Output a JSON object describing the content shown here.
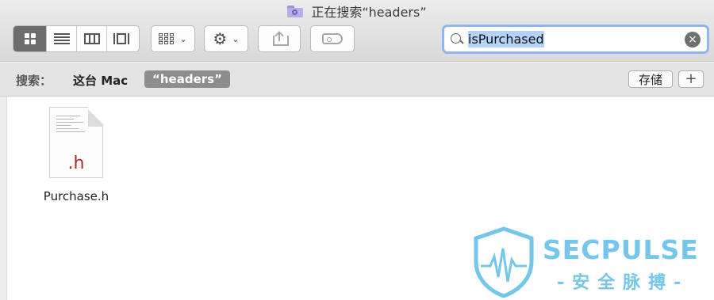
{
  "window": {
    "title": "正在搜索“headers”"
  },
  "toolbar": {
    "view_modes": [
      "icon-view",
      "list-view",
      "column-view",
      "cover-flow-view"
    ],
    "active_view": "icon-view",
    "arrange_icon": "grid-arrange-icon",
    "action_icon": "gear-icon",
    "share_icon": "share-icon",
    "tag_icon": "tag-icon"
  },
  "search": {
    "query": "isPurchased",
    "clear_icon": "clear-icon"
  },
  "scope": {
    "label": "搜索：",
    "this_mac": "这台 Mac",
    "folder": "“headers”",
    "save_label": "存储",
    "add_label": "+"
  },
  "results": [
    {
      "name": "Purchase.h",
      "ext": ".h"
    }
  ],
  "watermark": {
    "name": "SECPULSE",
    "sub": "-安全脉搏-"
  },
  "colors": {
    "selection": "#b3d3fb",
    "search_focus": "#8fb6ee",
    "extension": "#a82a2a",
    "watermark": "#74c6ea"
  }
}
